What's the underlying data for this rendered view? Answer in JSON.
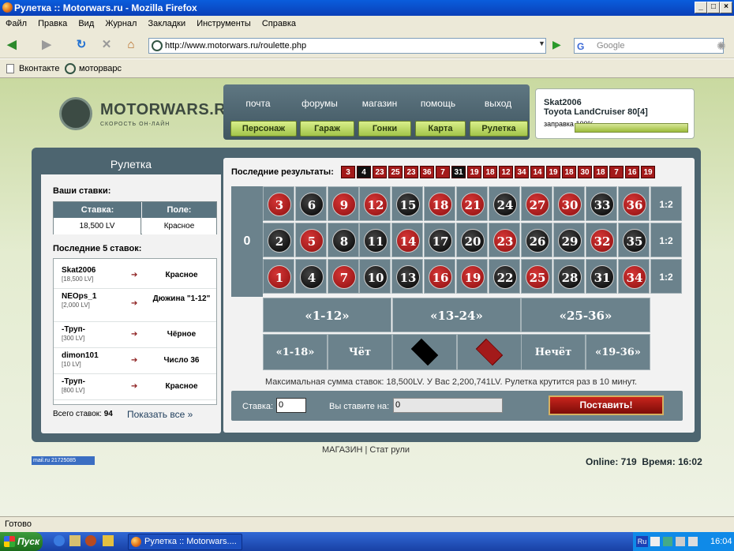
{
  "window": {
    "title": "Рулетка :: Motorwars.ru - Mozilla Firefox"
  },
  "menu": [
    "Файл",
    "Правка",
    "Вид",
    "Журнал",
    "Закладки",
    "Инструменты",
    "Справка"
  ],
  "toolbar": {
    "url": "http://www.motorwars.ru/roulette.php",
    "search_placeholder": "Google"
  },
  "bookmarks": [
    "Вконтакте",
    "моторварс"
  ],
  "site": {
    "logo_text": "MOTORWARS.RU",
    "logo_sub": "СКОРОСТЬ ОН-ЛАЙН",
    "nav_links": [
      "почта",
      "форумы",
      "магазин",
      "помощь",
      "выход"
    ],
    "nav_buttons": [
      "Персонаж",
      "Гараж",
      "Гонки",
      "Карта",
      "Рулетка"
    ],
    "user": {
      "name": "Skat2006",
      "car": "Toyota LandCruiser 80[4]",
      "fuel_label": "заправка 100%",
      "fuel_level": 1.0
    }
  },
  "roulette": {
    "title": "Рулетка",
    "your_bets_label": "Ваши ставки:",
    "bets_table": {
      "headers": [
        "Ставка:",
        "Поле:"
      ],
      "row": [
        "18,500 LV",
        "Красное"
      ]
    },
    "last5_label": "Последние 5 ставок:",
    "last5": [
      {
        "name": "Skat2006",
        "amount": "[18,500 LV]",
        "arrow": "➔",
        "field": "Красное"
      },
      {
        "name": "NEOps_1",
        "amount": "[2,000 LV]",
        "arrow": "➔",
        "field": "Дюжина \"1-12\""
      },
      {
        "name": "-Труп-",
        "amount": "[300 LV]",
        "arrow": "➔",
        "field": "Чёрное"
      },
      {
        "name": "dimon101",
        "amount": "[10 LV]",
        "arrow": "➔",
        "field": "Число 36"
      },
      {
        "name": "-Труп-",
        "amount": "[800 LV]",
        "arrow": "➔",
        "field": "Красное"
      }
    ],
    "total_label": "Всего ставок:",
    "total_value": "94",
    "show_all": "Показать все »",
    "last_results_label": "Последние результаты:",
    "last_results": [
      {
        "n": "3",
        "c": "red"
      },
      {
        "n": "4",
        "c": "blk"
      },
      {
        "n": "23",
        "c": "red"
      },
      {
        "n": "25",
        "c": "red"
      },
      {
        "n": "23",
        "c": "red"
      },
      {
        "n": "36",
        "c": "red"
      },
      {
        "n": "7",
        "c": "red"
      },
      {
        "n": "31",
        "c": "blk"
      },
      {
        "n": "19",
        "c": "red"
      },
      {
        "n": "18",
        "c": "red"
      },
      {
        "n": "12",
        "c": "red"
      },
      {
        "n": "34",
        "c": "red"
      },
      {
        "n": "14",
        "c": "red"
      },
      {
        "n": "19",
        "c": "red"
      },
      {
        "n": "18",
        "c": "red"
      },
      {
        "n": "30",
        "c": "red"
      },
      {
        "n": "18",
        "c": "red"
      },
      {
        "n": "7",
        "c": "red"
      },
      {
        "n": "16",
        "c": "red"
      },
      {
        "n": "19",
        "c": "red"
      }
    ],
    "zero": "0",
    "rows": [
      [
        {
          "n": "3",
          "c": "red"
        },
        {
          "n": "6",
          "c": "blk"
        },
        {
          "n": "9",
          "c": "red"
        },
        {
          "n": "12",
          "c": "red"
        },
        {
          "n": "15",
          "c": "blk"
        },
        {
          "n": "18",
          "c": "red"
        },
        {
          "n": "21",
          "c": "red"
        },
        {
          "n": "24",
          "c": "blk"
        },
        {
          "n": "27",
          "c": "red"
        },
        {
          "n": "30",
          "c": "red"
        },
        {
          "n": "33",
          "c": "blk"
        },
        {
          "n": "36",
          "c": "red"
        }
      ],
      [
        {
          "n": "2",
          "c": "blk"
        },
        {
          "n": "5",
          "c": "red"
        },
        {
          "n": "8",
          "c": "blk"
        },
        {
          "n": "11",
          "c": "blk"
        },
        {
          "n": "14",
          "c": "red"
        },
        {
          "n": "17",
          "c": "blk"
        },
        {
          "n": "20",
          "c": "blk"
        },
        {
          "n": "23",
          "c": "red"
        },
        {
          "n": "26",
          "c": "blk"
        },
        {
          "n": "29",
          "c": "blk"
        },
        {
          "n": "32",
          "c": "red"
        },
        {
          "n": "35",
          "c": "blk"
        }
      ],
      [
        {
          "n": "1",
          "c": "red"
        },
        {
          "n": "4",
          "c": "blk"
        },
        {
          "n": "7",
          "c": "red"
        },
        {
          "n": "10",
          "c": "blk"
        },
        {
          "n": "13",
          "c": "blk"
        },
        {
          "n": "16",
          "c": "red"
        },
        {
          "n": "19",
          "c": "red"
        },
        {
          "n": "22",
          "c": "blk"
        },
        {
          "n": "25",
          "c": "red"
        },
        {
          "n": "28",
          "c": "blk"
        },
        {
          "n": "31",
          "c": "blk"
        },
        {
          "n": "34",
          "c": "red"
        }
      ]
    ],
    "column_label": "1:2",
    "dozens": [
      "«1-12»",
      "«13-24»",
      "«25-36»"
    ],
    "outside": [
      "«1-18»",
      "Чёт",
      "",
      "",
      "Нечёт",
      "«19-36»"
    ],
    "info": "Максимальная сумма ставок: 18,500LV. У Вас 2,200,741LV. Рулетка крутится раз в 10 минут.",
    "stake_label": "Ставка:",
    "stake_value": "0",
    "you_bet_label": "Вы ставите на:",
    "you_bet_value": "0",
    "place_button": "Поставить!"
  },
  "footer": {
    "links": "МАГАЗИН | Стат рули",
    "counter": "mail.ru 21725085",
    "online": "Online: 719  Время: 16:02"
  },
  "statusbar": "Готово",
  "taskbar": {
    "start": "Пуск",
    "item": "Рулетка :: Motorwars....",
    "lang": "Ru",
    "clock": "16:04"
  },
  "colors": {
    "red": "#a31a1a",
    "black": "#111111",
    "panel": "#4d6570",
    "table": "#6b828c"
  }
}
